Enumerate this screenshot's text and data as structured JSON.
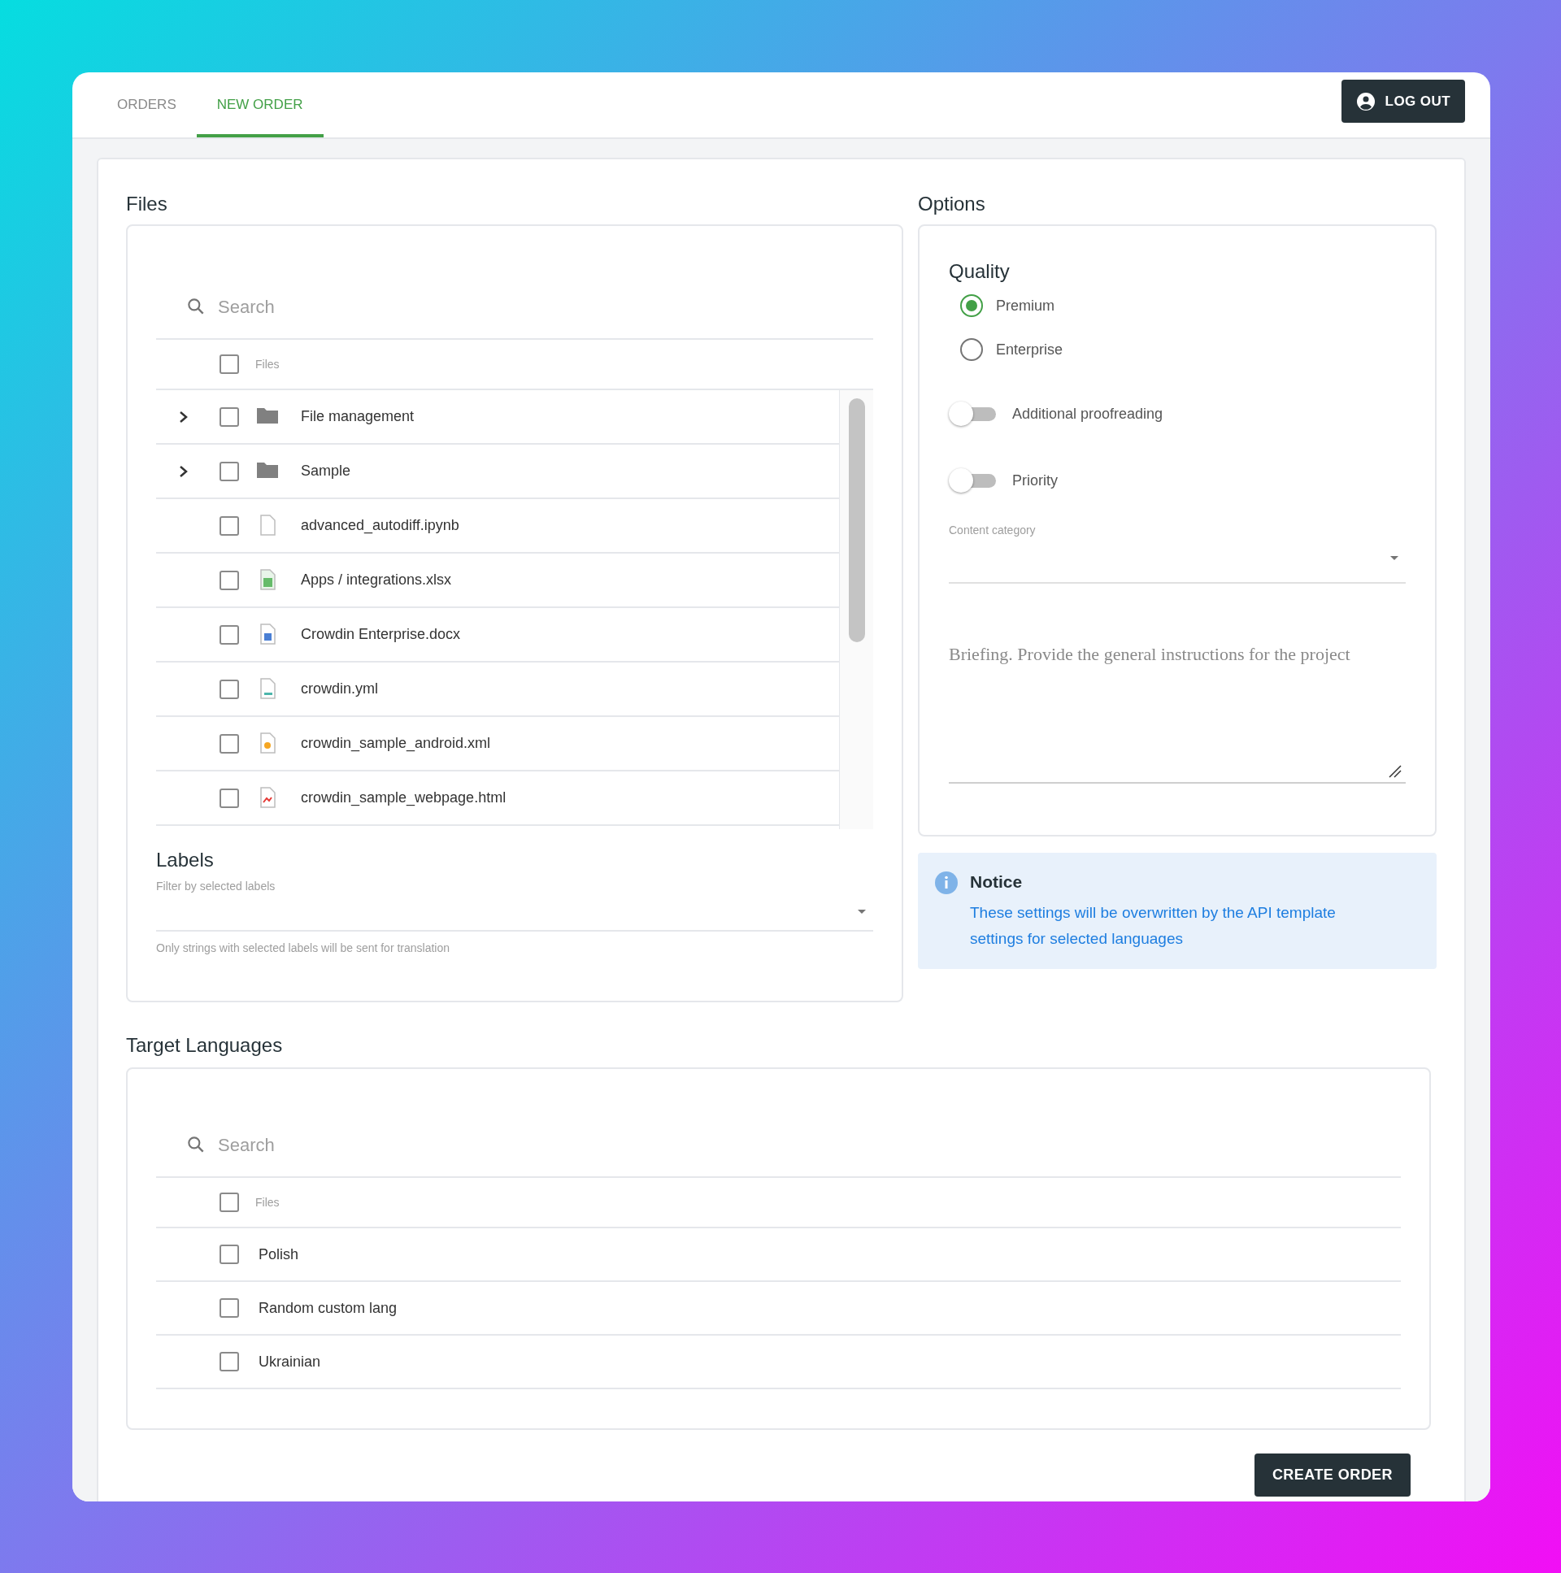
{
  "tabs": [
    {
      "label": "ORDERS",
      "selected": false
    },
    {
      "label": "NEW ORDER",
      "selected": true
    }
  ],
  "logout_button": "LOG OUT",
  "files": {
    "title": "Files",
    "search": {
      "placeholder": "Search"
    },
    "header": {
      "label": "Files",
      "checked": false
    },
    "rows": [
      {
        "name": "File management",
        "kind": "folder",
        "expanded": false,
        "checked": false
      },
      {
        "name": "Sample",
        "kind": "folder",
        "expanded": false,
        "checked": false
      },
      {
        "name": "advanced_autodiff.ipynb",
        "kind": "blank",
        "checked": false
      },
      {
        "name": "Apps / integrations.xlsx",
        "kind": "sheet",
        "checked": false
      },
      {
        "name": "Crowdin Enterprise.docx",
        "kind": "doc",
        "checked": false
      },
      {
        "name": "crowdin.yml",
        "kind": "yml",
        "checked": false
      },
      {
        "name": "crowdin_sample_android.xml",
        "kind": "xml",
        "checked": false
      },
      {
        "name": "crowdin_sample_webpage.html",
        "kind": "html",
        "checked": false
      }
    ],
    "labels": {
      "title": "Labels",
      "field_label": "Filter by selected labels",
      "helper": "Only strings with selected labels will be sent for translation"
    }
  },
  "options": {
    "title": "Options",
    "quality": {
      "title": "Quality",
      "options": [
        {
          "label": "Premium",
          "selected": true
        },
        {
          "label": "Enterprise",
          "selected": false
        }
      ]
    },
    "toggles": [
      {
        "label": "Additional proofreading",
        "on": false
      },
      {
        "label": "Priority",
        "on": false
      }
    ],
    "content_category": {
      "label": "Content category"
    },
    "briefing": {
      "placeholder": "Briefing. Provide the general instructions for the project"
    }
  },
  "notice": {
    "title": "Notice",
    "text": "These settings will be overwritten by the API template settings for selected languages"
  },
  "target_languages": {
    "title": "Target Languages",
    "search": {
      "placeholder": "Search"
    },
    "header": {
      "label": "Files",
      "checked": false
    },
    "rows": [
      {
        "name": "Polish",
        "checked": false
      },
      {
        "name": "Random custom lang",
        "checked": false
      },
      {
        "name": "Ukrainian",
        "checked": false
      }
    ]
  },
  "create_button": "CREATE ORDER"
}
